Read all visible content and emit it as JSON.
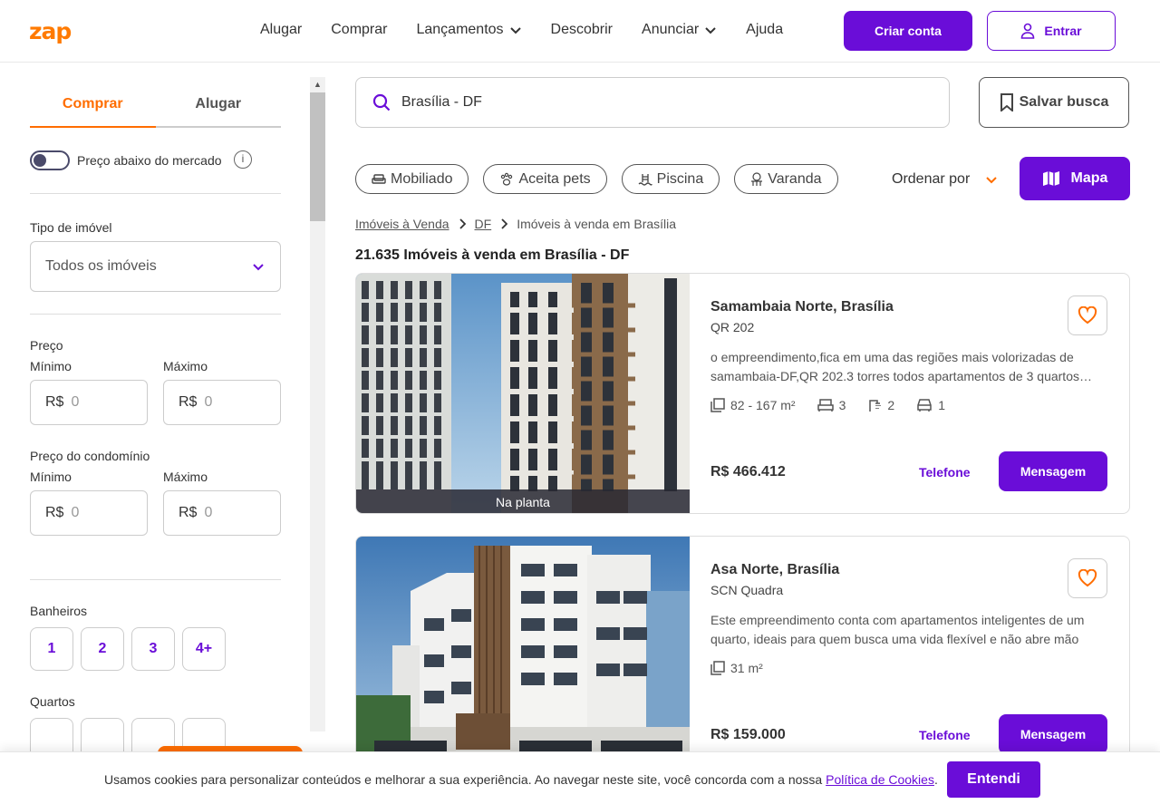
{
  "header": {
    "logo": "zap",
    "nav": [
      "Alugar",
      "Comprar",
      "Lançamentos",
      "Descobrir",
      "Anunciar",
      "Ajuda"
    ],
    "criar_conta": "Criar conta",
    "entrar": "Entrar"
  },
  "sidebar": {
    "tabs": [
      "Comprar",
      "Alugar"
    ],
    "active_tab": "Comprar",
    "toggle_label": "Preço abaixo do mercado",
    "tipo_label": "Tipo de imóvel",
    "tipo_value": "Todos os imóveis",
    "preco_label": "Preço",
    "min_label": "Mínimo",
    "max_label": "Máximo",
    "currency": "R$",
    "price_min": "0",
    "price_max": "0",
    "condo_label": "Preço do condomínio",
    "condo_min": "0",
    "condo_max": "0",
    "banheiros_label": "Banheiros",
    "banheiros": [
      "1",
      "2",
      "3",
      "4+"
    ],
    "quartos_label": "Quartos"
  },
  "search": {
    "value": "Brasília - DF",
    "salvar": "Salvar busca"
  },
  "chips": [
    "Mobiliado",
    "Aceita pets",
    "Piscina",
    "Varanda"
  ],
  "ordenar": "Ordenar por",
  "mapa": "Mapa",
  "breadcrumb": [
    "Imóveis à Venda",
    "DF",
    "Imóveis à venda em Brasília"
  ],
  "results_title": "21.635 Imóveis à venda em Brasília - DF",
  "listings": [
    {
      "title": "Samambaia Norte, Brasília",
      "street": "QR 202",
      "description": "o empreendimento,fica em uma das regiões mais volorizadas de samambaia-DF,QR 202.3 torres todos apartamentos de 3 quartos…",
      "area": "82 - 167 m²",
      "bedrooms": "3",
      "bathrooms": "2",
      "parking": "1",
      "price": "R$ 466.412",
      "badge": "Na planta",
      "telefone": "Telefone",
      "mensagem": "Mensagem"
    },
    {
      "title": "Asa Norte, Brasília",
      "street": "SCN Quadra",
      "description": "Este empreendimento conta com apartamentos inteligentes de um quarto, ideais para quem busca uma vida flexível e não abre mão da…",
      "area": "31 m²",
      "price": "R$ 159.000",
      "telefone": "Telefone",
      "mensagem": "Mensagem"
    }
  ],
  "cookie": {
    "text": "Usamos cookies para personalizar conteúdos e melhorar a sua experiência. Ao navegar neste site, você concorda com a nossa ",
    "link": "Política de Cookies",
    "end": ".",
    "button": "Entendi"
  },
  "colors": {
    "brand": "#6a0dd8",
    "accent": "#ff6d00"
  }
}
